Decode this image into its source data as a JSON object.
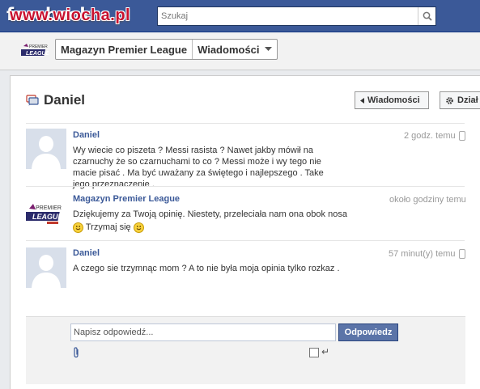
{
  "header": {
    "logo": "facebook",
    "watermark": "www.wiocha.pl",
    "search_placeholder": "Szukaj"
  },
  "page_bar": {
    "page_name": "Magazyn Premier League",
    "section": "Wiadomości"
  },
  "thread": {
    "title": "Daniel",
    "back_button": "Wiadomości",
    "actions_button": "Dział"
  },
  "messages": [
    {
      "author": "Daniel",
      "time": "2 godz. temu",
      "text": "Wy wiecie co piszeta ? Messi rasista ? Nawet jakby mówił na czarnuchy że so czarnuchami to co ? Messi może i wy tego nie macie pisać . Ma być uważany za świętego i najlepszego . Take jego przeznaczenie ."
    },
    {
      "author": "Magazyn Premier League",
      "time": "około godziny temu",
      "text_line1": "Dziękujemy za Twoją opinię. Niestety, przeleciała nam ona obok nosa",
      "text_line2": "Trzymaj się"
    },
    {
      "author": "Daniel",
      "time": "57 minut(y) temu",
      "text": "A czego sie trzymnąc mom ? A to nie była moja opinia tylko rozkaz ."
    }
  ],
  "reply": {
    "placeholder": "Napisz odpowiedź...",
    "button": "Odpowiedz"
  },
  "colors": {
    "facebook_blue": "#3b5998",
    "link_blue": "#3b5998",
    "reply_button": "#5b74a8",
    "watermark_red": "#c8102e"
  }
}
